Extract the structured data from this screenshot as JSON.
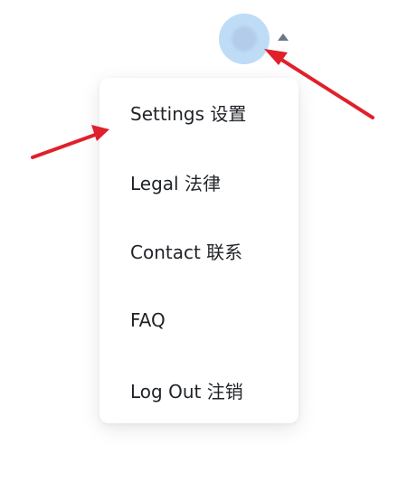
{
  "header": {
    "avatar_icon": "user-avatar",
    "caret_icon": "caret-up-icon"
  },
  "menu": {
    "items": [
      {
        "label": "Settings 设置"
      },
      {
        "label": "Legal 法律"
      },
      {
        "label": "Contact 联系"
      },
      {
        "label": "FAQ"
      },
      {
        "label": "Log Out 注销"
      }
    ]
  },
  "annotations": {
    "arrow_color": "#e0202a"
  },
  "colors": {
    "avatar_bg": "#bfdcf7",
    "caret": "#6a7689",
    "text": "#1f2328"
  }
}
